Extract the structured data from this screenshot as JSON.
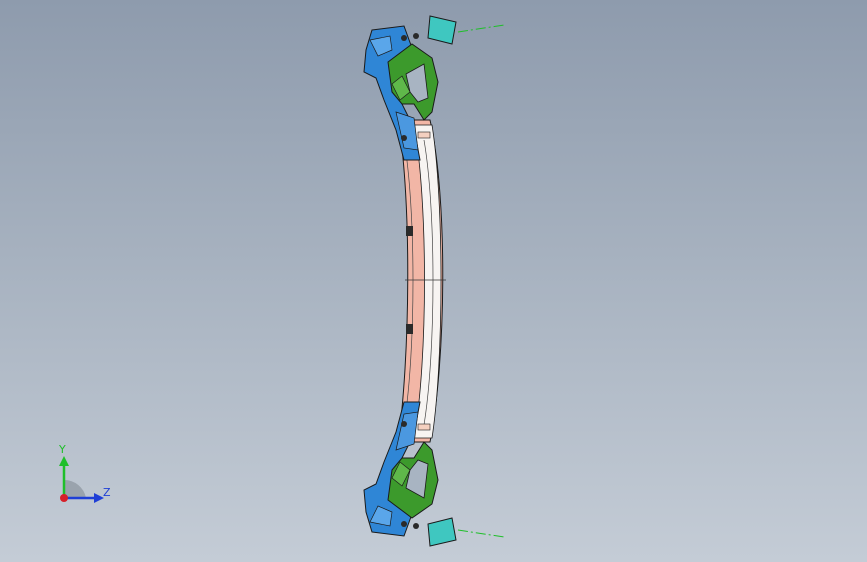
{
  "viewport": {
    "background_top": "#8e9bad",
    "background_bottom": "#c4ccd6"
  },
  "model": {
    "part_colors": {
      "bracket_green": "#3c9a2c",
      "bracket_blue": "#2f86d6",
      "beam_pink": "#f2b6a6",
      "beam_white": "#f7f4f2",
      "pad_cyan": "#3fc7c0",
      "edge": "#1a1a1a"
    }
  },
  "triad": {
    "y_label": "Y",
    "z_label": "Z",
    "y_color": "#1fbf2a",
    "z_color": "#1f3fd6",
    "x_color": "#d6202a"
  }
}
